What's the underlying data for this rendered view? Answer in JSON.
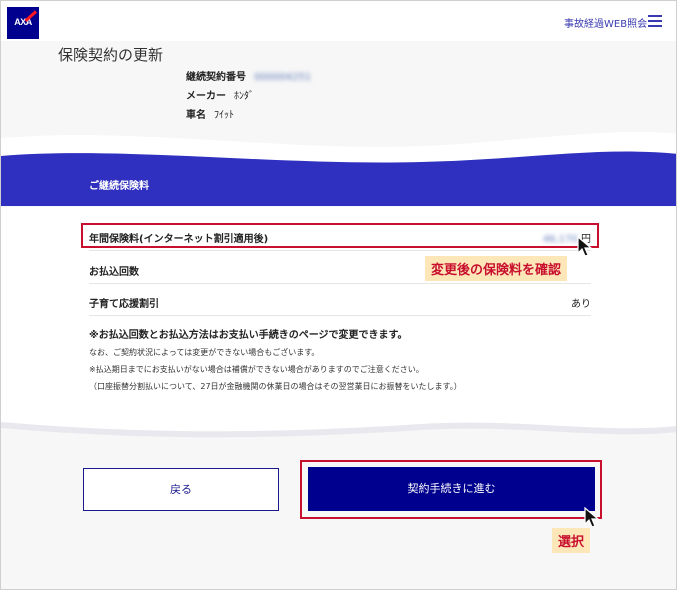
{
  "header": {
    "logo_text": "AXA",
    "link_label": "事故経過WEB照会"
  },
  "contract": {
    "page_title": "保険契約の更新",
    "number_label": "継続契約番号",
    "number_value": "000004251",
    "maker_label": "メーカー",
    "maker_value": "ﾎﾝﾀﾞ",
    "car_label": "車名",
    "car_value": "ﾌｲｯﾄ"
  },
  "premium": {
    "section_title": "ご継続保険料",
    "rows": [
      {
        "label": "年間保険料(インターネット割引適用後)",
        "value": "46,170",
        "unit": "円"
      },
      {
        "label": "お払込回数",
        "value": ""
      },
      {
        "label": "子育て応援割引",
        "value": "あり"
      }
    ],
    "note_bold": "※お払込回数とお払込方法はお支払い手続きのページで変更できます。",
    "notes": [
      "なお、ご契約状況によっては変更ができない場合もございます。",
      "※払込期日までにお支払いがない場合は補償ができない場合がありますのでご注意ください。",
      "（口座振替分割払いについて、27日が金融機関の休業日の場合はその翌営業日にお振替をいたします。）"
    ]
  },
  "annotations": {
    "confirm_label": "変更後の保険料を確認",
    "select_label": "選択"
  },
  "buttons": {
    "back_label": "戻る",
    "proceed_label": "契約手続きに進む"
  },
  "colors": {
    "brand_blue": "#00008f",
    "banner_blue": "#3030c0",
    "highlight_red": "#c8102e",
    "annotation_bg": "#fde6b8"
  }
}
